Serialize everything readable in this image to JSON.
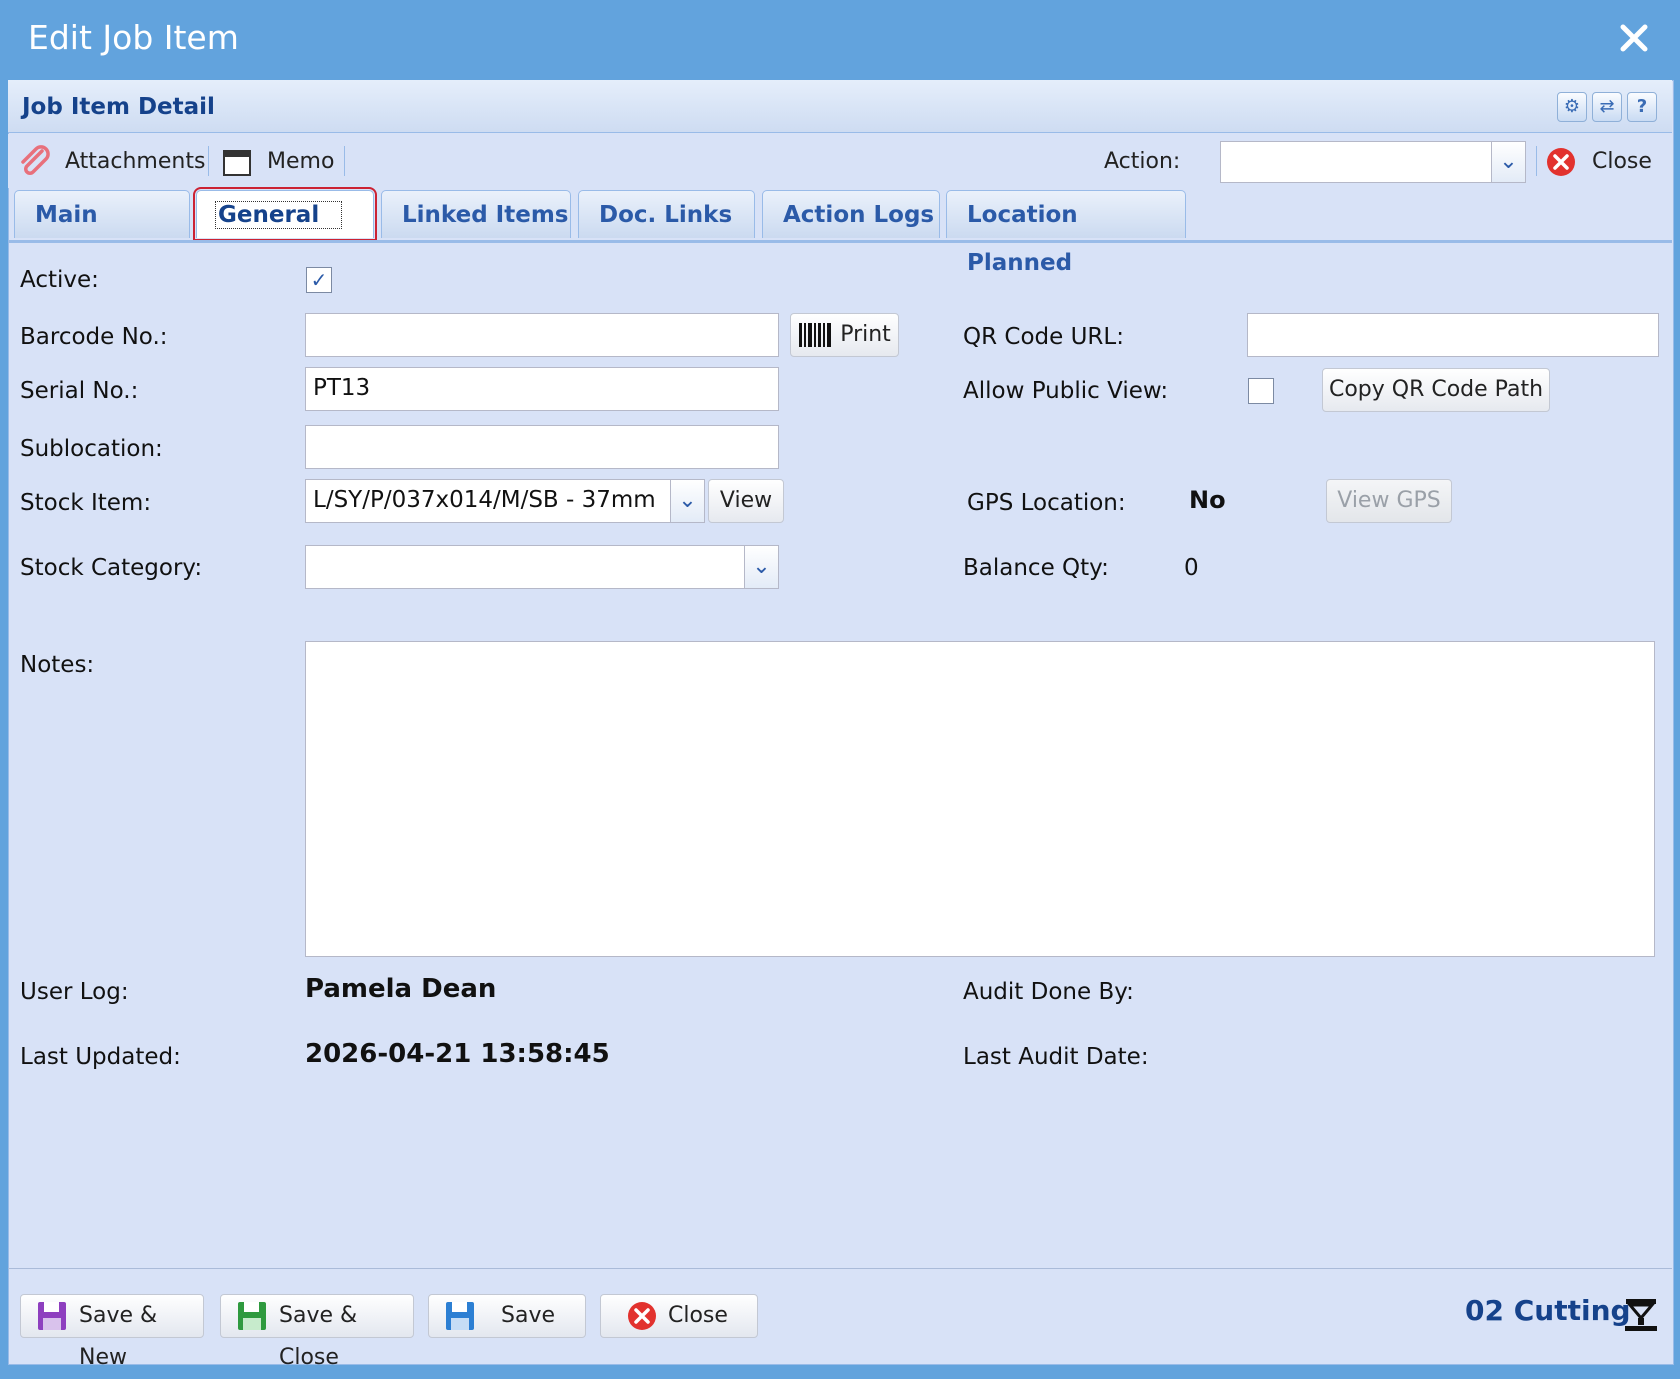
{
  "window": {
    "title": "Edit Job Item"
  },
  "panel": {
    "title": "Job Item Detail"
  },
  "toolbar": {
    "attachments_label": "Attachments",
    "memo_label": "Memo",
    "action_label": "Action:",
    "action_value": "",
    "close_label": "Close"
  },
  "tabs": [
    {
      "label": "Main"
    },
    {
      "label": "General"
    },
    {
      "label": "Linked Items"
    },
    {
      "label": "Doc. Links"
    },
    {
      "label": "Action Logs"
    },
    {
      "label": "Location Planned"
    }
  ],
  "active_tab": "General",
  "form": {
    "active_label": "Active:",
    "active_checked": true,
    "barcode_label": "Barcode No.:",
    "barcode_value": "",
    "print_label": "Print",
    "qr_url_label": "QR Code URL:",
    "qr_url_value": "",
    "serial_label": "Serial No.:",
    "serial_value": "PT13",
    "allow_public_label": "Allow Public View:",
    "allow_public_checked": false,
    "copy_qr_label": "Copy QR Code Path",
    "sublocation_label": "Sublocation:",
    "sublocation_value": "",
    "stock_item_label": "Stock Item:",
    "stock_item_value": "L/SY/P/037x014/M/SB - 37mm",
    "view_label": "View",
    "gps_label": "GPS Location:",
    "gps_value": "No",
    "view_gps_label": "View GPS",
    "stock_category_label": "Stock Category:",
    "stock_category_value": "",
    "balance_qty_label": "Balance Qty:",
    "balance_qty_value": "0",
    "notes_label": "Notes:",
    "notes_value": "",
    "user_log_label": "User Log:",
    "user_log_value": "Pamela Dean",
    "audit_done_by_label": "Audit Done By:",
    "audit_done_by_value": "",
    "last_updated_label": "Last Updated:",
    "last_updated_value": "2026-04-21 13:58:45",
    "last_audit_date_label": "Last Audit Date:",
    "last_audit_date_value": ""
  },
  "footer": {
    "save_new_label": "Save & New",
    "save_close_label": "Save & Close",
    "save_label": "Save",
    "close_label": "Close",
    "status_text": "02 Cutting"
  },
  "colors": {
    "title_bar": "#62a3dd",
    "panel_bg": "#d8e2f7",
    "accent_text": "#15428b",
    "active_tab_outline": "#cc2233"
  },
  "icons": {
    "close_window": "close-icon",
    "attachments": "paperclip-icon",
    "memo": "calendar-icon",
    "action_close": "red-x-circle-icon",
    "print": "barcode-icon",
    "save_new": "purple-floppy-icon",
    "save_close": "green-floppy-icon",
    "save": "blue-floppy-icon",
    "status": "machine-icon"
  }
}
